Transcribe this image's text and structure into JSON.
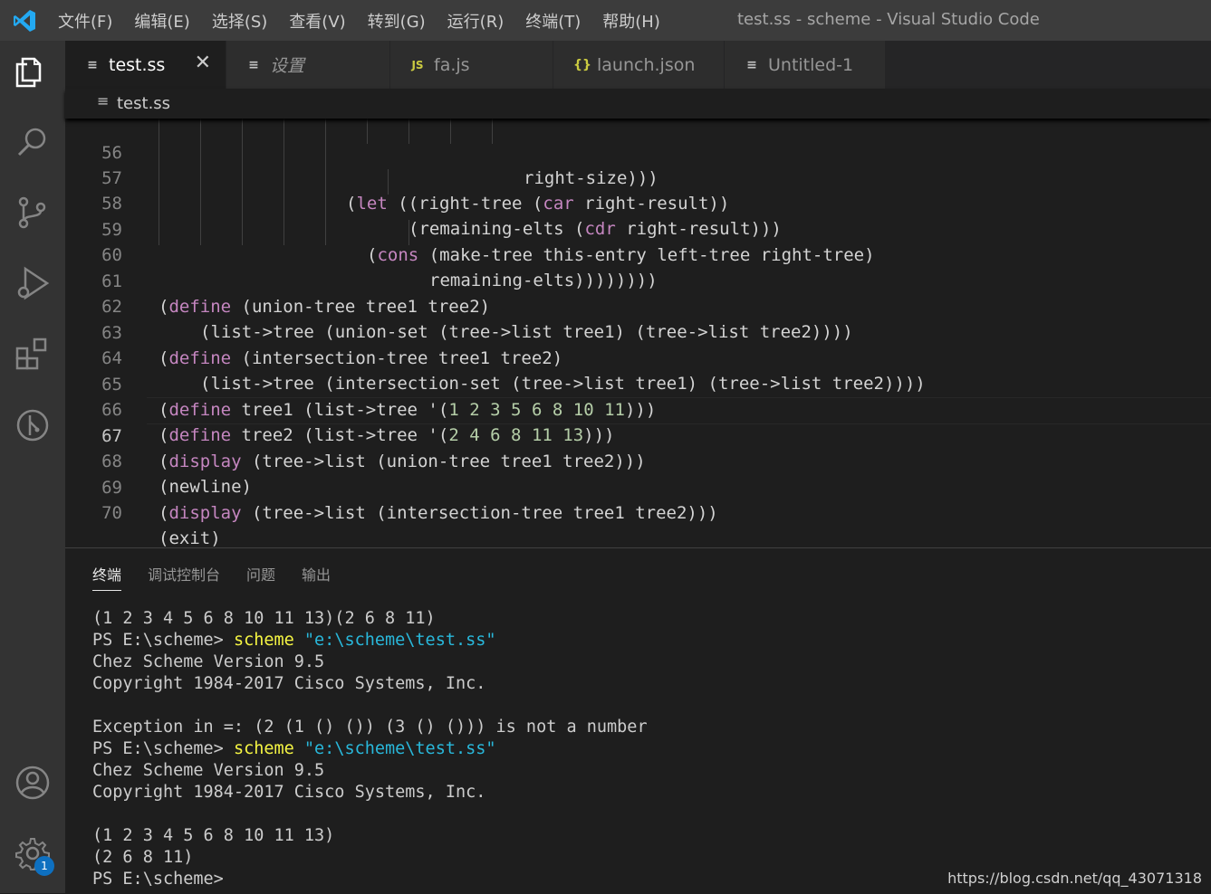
{
  "titlebar": {
    "menu": [
      "文件(F)",
      "编辑(E)",
      "选择(S)",
      "查看(V)",
      "转到(G)",
      "运行(R)",
      "终端(T)",
      "帮助(H)"
    ],
    "window_title": "test.ss - scheme - Visual Studio Code"
  },
  "activitybar": {
    "icons": [
      "explorer-icon",
      "search-icon",
      "source-control-icon",
      "run-debug-icon",
      "extensions-icon",
      "git-graph-icon",
      "account-icon",
      "settings-gear-icon"
    ],
    "settings_badge": "1"
  },
  "tabs": [
    {
      "label": "test.ss",
      "icon": "≡",
      "active": true
    },
    {
      "label": "设置",
      "icon": "≡",
      "active": false
    },
    {
      "label": "fa.js",
      "icon": "JS",
      "active": false
    },
    {
      "label": "launch.json",
      "icon": "{}",
      "active": false
    },
    {
      "label": "Untitled-1",
      "icon": "≡",
      "active": false
    }
  ],
  "breadcrumb": {
    "file": "test.ss"
  },
  "editor": {
    "line_numbers": [
      "56",
      "57",
      "58",
      "59",
      "60",
      "61",
      "62",
      "63",
      "64",
      "65",
      "66",
      "67",
      "68",
      "69",
      "70"
    ],
    "current_line": "67",
    "lines": [
      "right-size)))",
      "(let ((right-tree (car right-result))",
      "(remaining-elts (cdr right-result)))",
      "(cons (make-tree this-entry left-tree right-tree)",
      "remaining-elts))))))))",
      "(define (union-tree tree1 tree2)",
      "(list->tree (union-set (tree->list tree1) (tree->list tree2))))",
      "(define (intersection-tree tree1 tree2)",
      "(list->tree (intersection-set (tree->list tree1) (tree->list tree2))))",
      "(define tree1 (list->tree '(1 2 3 5 6 8 10 11)))",
      "(define tree2 (list->tree '(2 4 6 8 11 13)))",
      "(display (tree->list (union-tree tree1 tree2)))",
      "(newline)",
      "(display (tree->list (intersection-tree tree1 tree2)))",
      "(exit)"
    ]
  },
  "panel": {
    "tabs": [
      "终端",
      "调试控制台",
      "问题",
      "输出"
    ],
    "active_tab": "终端",
    "terminal": {
      "l0": "(1 2 3 4 5 6 8 10 11 13)(2 6 8 11)",
      "prompt": "PS E:\\scheme>",
      "cmd": "scheme",
      "arg": "\"e:\\scheme\\test.ss\"",
      "chez": "Chez Scheme Version 9.5",
      "copyright": "Copyright 1984-2017 Cisco Systems, Inc.",
      "exception": "Exception in =: (2 (1 () ()) (3 () ())) is not a number",
      "r1": "(1 2 3 4 5 6 8 10 11 13)",
      "r2": "(2 6 8 11)"
    }
  },
  "watermark": "https://blog.csdn.net/qq_43071318",
  "colors": {
    "accent": "#0e70c0",
    "keyword": "#c586c0",
    "function": "#dcdcaa",
    "variable": "#9cdcfe",
    "number": "#b5cea8"
  }
}
